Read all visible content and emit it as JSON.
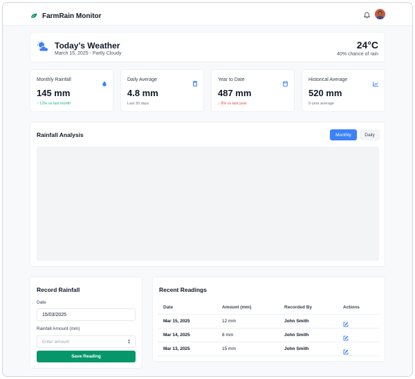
{
  "app": {
    "name": "FarmRain Monitor"
  },
  "header": {
    "icons": [
      "leaf-icon",
      "bell-icon",
      "avatar"
    ],
    "accent": "#059669"
  },
  "weather": {
    "title": "Today's Weather",
    "subtitle": "March 15, 2025 - Partly Cloudy",
    "temperature": "24°C",
    "chance": "40% chance of rain",
    "icon": "partly-cloudy-icon"
  },
  "stats": [
    {
      "label": "Monthly Rainfall",
      "value": "145 mm",
      "note": "↑ 12% vs last month",
      "trend": "up",
      "icon": "droplet-icon"
    },
    {
      "label": "Daily Average",
      "value": "4.8 mm",
      "note": "Last 30 days",
      "trend": "none",
      "icon": "calculator-icon"
    },
    {
      "label": "Year to Date",
      "value": "487 mm",
      "note": "↓ 8% vs last year",
      "trend": "down",
      "icon": "calendar-icon"
    },
    {
      "label": "Historical Average",
      "value": "520 mm",
      "note": "5-year average",
      "trend": "none",
      "icon": "chart-line-icon"
    }
  ],
  "analysis": {
    "title": "Rainfall Analysis",
    "toggles": [
      {
        "label": "Monthly",
        "active": true
      },
      {
        "label": "Daily",
        "active": false
      }
    ]
  },
  "record": {
    "title": "Record Rainfall",
    "date_label": "Date",
    "date_value": "15/03/2025",
    "amount_label": "Rainfall Amount (mm)",
    "amount_placeholder": "Enter amount",
    "save_label": "Save Reading"
  },
  "readings": {
    "title": "Recent Readings",
    "columns": [
      "Date",
      "Amount (mm)",
      "Recorded By",
      "Actions"
    ],
    "rows": [
      {
        "date": "Mar 15, 2025",
        "amount": "12 mm",
        "by": "John Smith"
      },
      {
        "date": "Mar 14, 2025",
        "amount": "8 mm",
        "by": "John Smith"
      },
      {
        "date": "Mar 13, 2025",
        "amount": "15 mm",
        "by": "John Smith"
      }
    ]
  },
  "colors": {
    "primary": "#3b82f6",
    "success": "#059669",
    "up": "#10b981",
    "down": "#ef4444"
  }
}
